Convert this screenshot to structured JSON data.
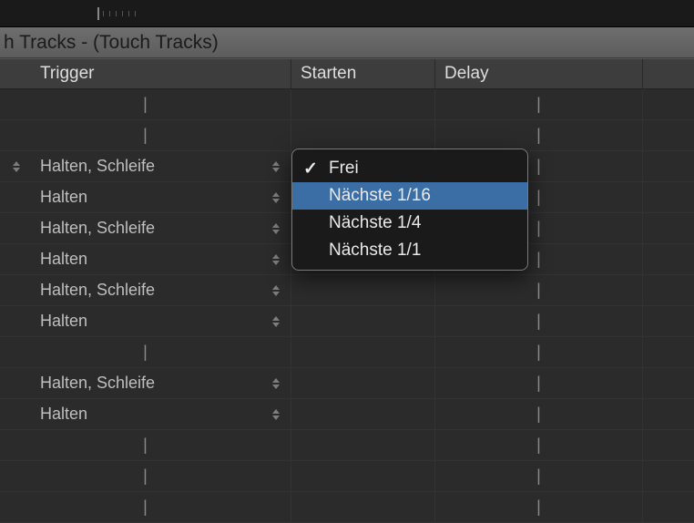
{
  "title": "h Tracks - (Touch Tracks)",
  "columns": {
    "trigger": "Trigger",
    "starten": "Starten",
    "delay": "Delay"
  },
  "rows": [
    {
      "trigger": "",
      "starten": "",
      "delay": "",
      "has_stepper": false,
      "has_left_stepper": false
    },
    {
      "trigger": "",
      "starten": "",
      "delay": "",
      "has_stepper": false,
      "has_left_stepper": false
    },
    {
      "trigger": "Halten, Schleife",
      "starten": "",
      "delay": "",
      "has_stepper": true,
      "has_left_stepper": true
    },
    {
      "trigger": "Halten",
      "starten": "",
      "delay": "",
      "has_stepper": true,
      "has_left_stepper": false
    },
    {
      "trigger": "Halten, Schleife",
      "starten": "",
      "delay": "",
      "has_stepper": true,
      "has_left_stepper": false
    },
    {
      "trigger": "Halten",
      "starten": "",
      "delay": "",
      "has_stepper": true,
      "has_left_stepper": false
    },
    {
      "trigger": "Halten, Schleife",
      "starten": "",
      "delay": "",
      "has_stepper": true,
      "has_left_stepper": false
    },
    {
      "trigger": "Halten",
      "starten": "",
      "delay": "",
      "has_stepper": true,
      "has_left_stepper": false
    },
    {
      "trigger": "",
      "starten": "",
      "delay": "",
      "has_stepper": false,
      "has_left_stepper": false
    },
    {
      "trigger": "Halten, Schleife",
      "starten": "",
      "delay": "",
      "has_stepper": true,
      "has_left_stepper": false
    },
    {
      "trigger": "Halten",
      "starten": "",
      "delay": "",
      "has_stepper": true,
      "has_left_stepper": false
    },
    {
      "trigger": "",
      "starten": "",
      "delay": "",
      "has_stepper": false,
      "has_left_stepper": false
    },
    {
      "trigger": "",
      "starten": "",
      "delay": "",
      "has_stepper": false,
      "has_left_stepper": false
    },
    {
      "trigger": "",
      "starten": "",
      "delay": "",
      "has_stepper": false,
      "has_left_stepper": false
    }
  ],
  "popup": {
    "items": [
      {
        "label": "Frei",
        "checked": true,
        "selected": false
      },
      {
        "label": "Nächste 1/16",
        "checked": false,
        "selected": true
      },
      {
        "label": "Nächste 1/4",
        "checked": false,
        "selected": false
      },
      {
        "label": "Nächste 1/1",
        "checked": false,
        "selected": false
      }
    ]
  },
  "dash": "|"
}
